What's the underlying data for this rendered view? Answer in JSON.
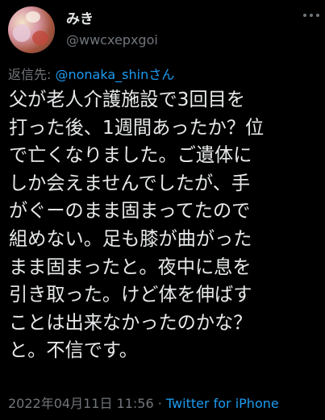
{
  "author": {
    "display_name": "みき",
    "handle": "@wwcxepxgoi"
  },
  "reply": {
    "prefix": "返信先: ",
    "mention": "@nonaka_shinさん"
  },
  "tweet": {
    "lines": [
      "父が老人介護施設で3回目を",
      "打った後、1週間あったか？位",
      "で亡くなりました。ご遺体に",
      "しか会えませんでしたが、手",
      "がぐーのまま固まってたので",
      "組めない。足も膝が曲がった",
      "まま固まったと。夜中に息を",
      "引き取った。けど体を伸ばす",
      "ことは出来なかったのかな？",
      "と。不信です。"
    ]
  },
  "meta": {
    "timestamp": "2022年04月11日 11:56",
    "separator": " · ",
    "source": "Twitter for iPhone"
  },
  "icons": {
    "more": "more-horizontal-icon",
    "avatar": "avatar-photo"
  },
  "colors": {
    "background": "#000000",
    "text": "#e7e9ea",
    "muted": "#71767b",
    "link": "#1d9bf0"
  }
}
